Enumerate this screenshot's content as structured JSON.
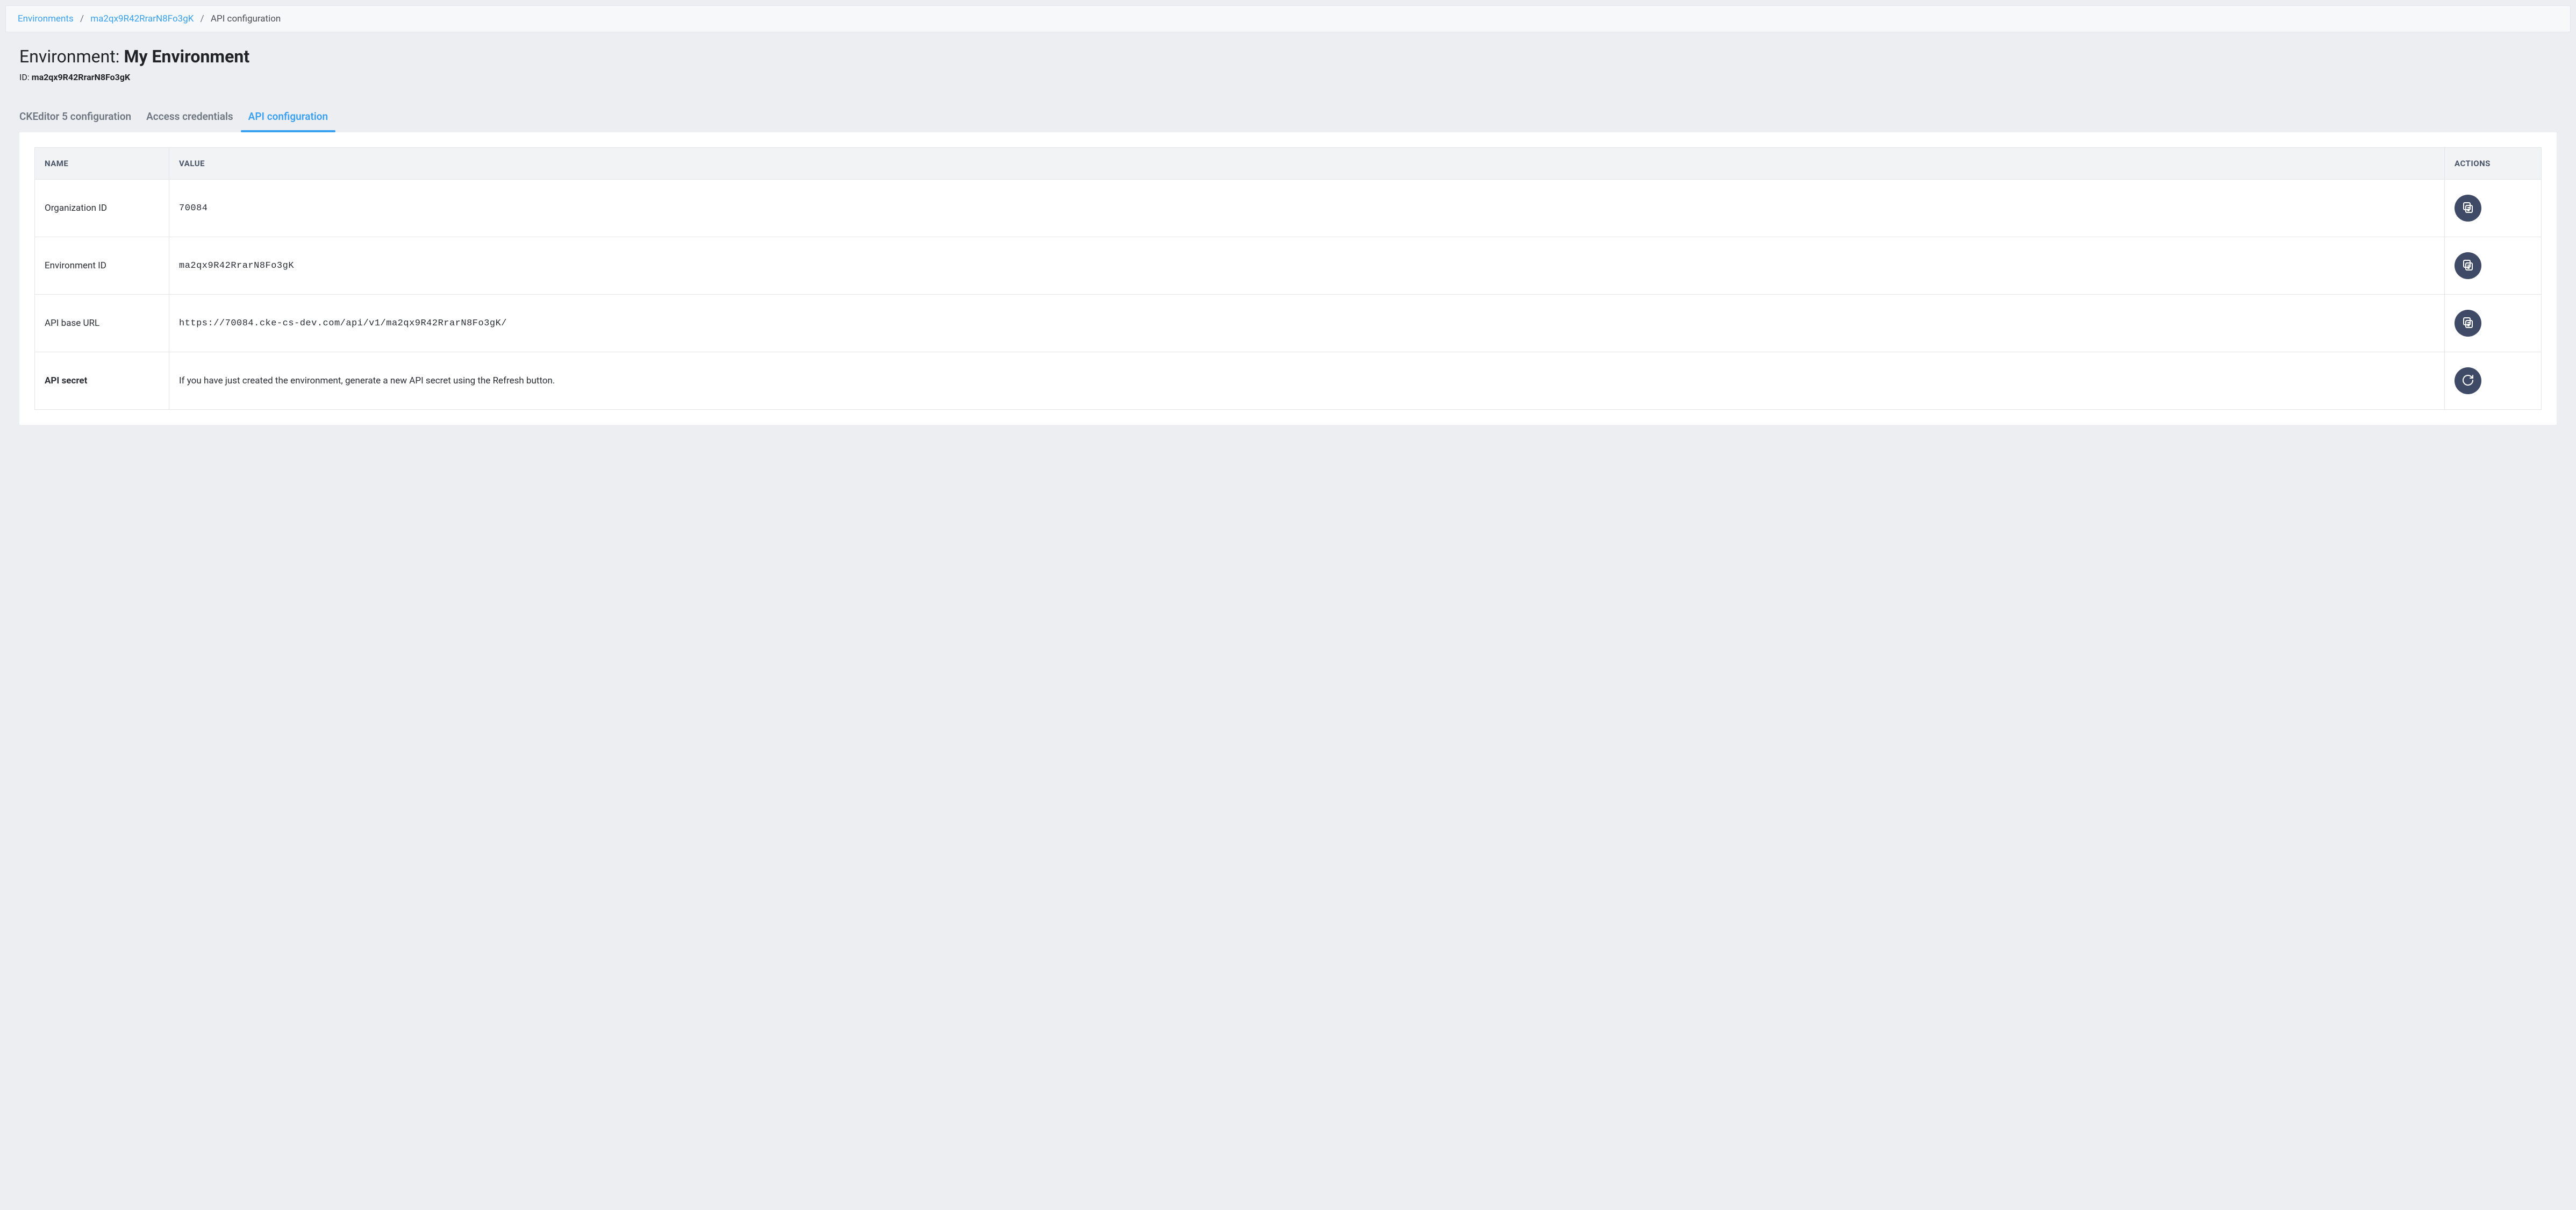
{
  "breadcrumb": {
    "items": [
      {
        "label": "Environments",
        "link": true
      },
      {
        "label": "ma2qx9R42RrarN8Fo3gK",
        "link": true
      },
      {
        "label": "API configuration",
        "link": false
      }
    ]
  },
  "header": {
    "title_prefix": "Environment: ",
    "title_name": "My Environment",
    "id_label": "ID: ",
    "id_value": "ma2qx9R42RrarN8Fo3gK"
  },
  "tabs": [
    {
      "label": "CKEditor 5 configuration",
      "active": false
    },
    {
      "label": "Access credentials",
      "active": false
    },
    {
      "label": "API configuration",
      "active": true
    }
  ],
  "table": {
    "headers": {
      "name": "NAME",
      "value": "VALUE",
      "actions": "ACTIONS"
    },
    "rows": [
      {
        "name": "Organization ID",
        "value": "70084",
        "mono": true,
        "bold_name": false,
        "action": "copy"
      },
      {
        "name": "Environment ID",
        "value": "ma2qx9R42RrarN8Fo3gK",
        "mono": true,
        "bold_name": false,
        "action": "copy"
      },
      {
        "name": "API base URL",
        "value": "https://70084.cke-cs-dev.com/api/v1/ma2qx9R42RrarN8Fo3gK/",
        "mono": true,
        "bold_name": false,
        "action": "copy"
      },
      {
        "name": "API secret",
        "value": "If you have just created the environment, generate a new API secret using the Refresh button.",
        "mono": false,
        "bold_name": true,
        "action": "refresh"
      }
    ]
  }
}
